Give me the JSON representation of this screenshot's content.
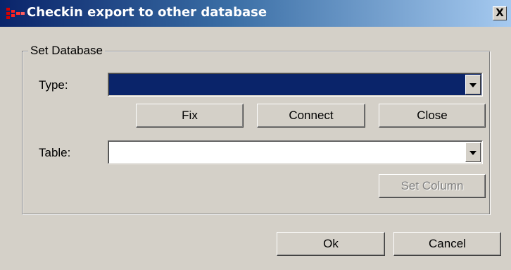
{
  "window": {
    "title": "Checkin export to other database",
    "close_label": "X",
    "app_icon": "app-logo-icon"
  },
  "group": {
    "legend": "Set Database"
  },
  "type_field": {
    "label": "Type:",
    "value": "",
    "state": "selected-highlighted"
  },
  "table_field": {
    "label": "Table:",
    "value": ""
  },
  "buttons": {
    "fix": "Fix",
    "connect": "Connect",
    "close": "Close",
    "set_column": "Set Column",
    "set_column_enabled": false,
    "ok": "Ok",
    "cancel": "Cancel"
  },
  "colors": {
    "titlebar_start": "#0a246a",
    "titlebar_end": "#a6caf0",
    "dialog_bg": "#d4d0c8",
    "selection": "#0a246a",
    "icon_red": "#d40000"
  }
}
